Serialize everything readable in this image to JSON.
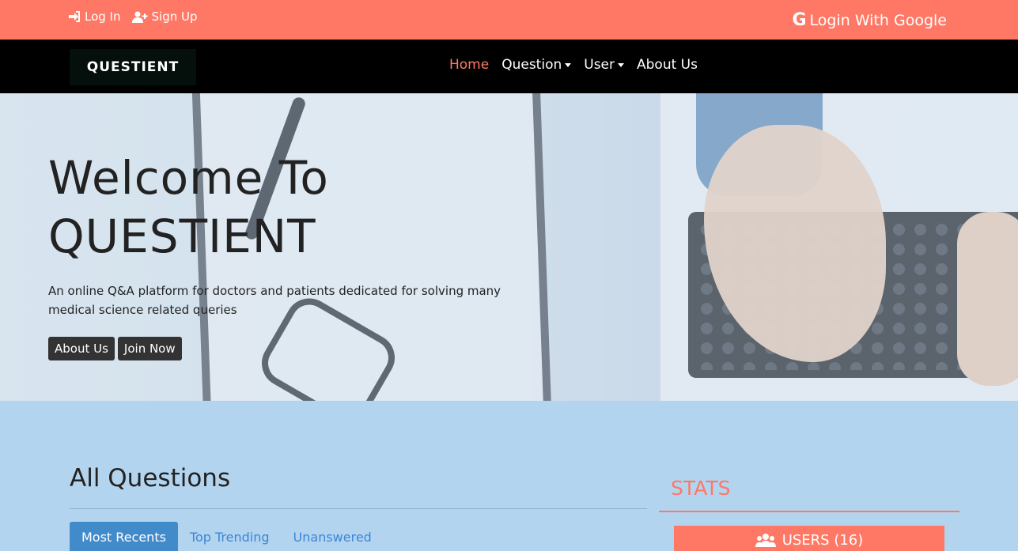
{
  "topbar": {
    "login_label": "Log In",
    "signup_label": "Sign Up",
    "google_label": "Login With Google",
    "background": "#ff7866"
  },
  "navbar": {
    "brand": "QUESTIENT",
    "items": [
      {
        "label": "Home",
        "active": true
      },
      {
        "label": "Question",
        "dropdown": true
      },
      {
        "label": "User",
        "dropdown": true
      },
      {
        "label": "About Us"
      }
    ]
  },
  "hero": {
    "title_line1": "Welcome To",
    "title_line2": "QUESTIENT",
    "subtitle": "An online Q&A platform for doctors and patients dedicated for solving many medical science related queries",
    "buttons": [
      "About Us",
      "Join Now"
    ]
  },
  "main": {
    "title": "All Questions",
    "tabs": [
      {
        "label": "Most Recents",
        "active": true
      },
      {
        "label": "Top Trending"
      },
      {
        "label": "Unanswered"
      }
    ]
  },
  "stats": {
    "title": "STATS",
    "users_label": "USERS (16)"
  },
  "colors": {
    "accent": "#ff7866",
    "page_bg": "#b3d4ef",
    "tab_active": "#428bca"
  }
}
